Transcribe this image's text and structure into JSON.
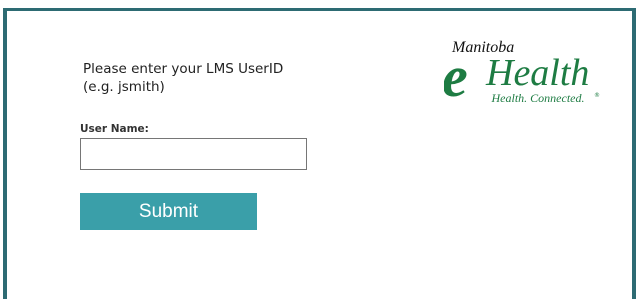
{
  "login": {
    "prompt_line1": "Please enter your LMS UserID",
    "prompt_line2": "(e.g. jsmith)",
    "username_label": "User Name:",
    "username_value": "",
    "submit_label": "Submit"
  },
  "logo": {
    "top_text": "Manitoba",
    "letter": "e",
    "main_text": "Health",
    "tagline": "Health. Connected.",
    "registered_mark": "®"
  },
  "colors": {
    "frame": "#2d6b73",
    "button": "#3a9fa9",
    "logo_green": "#1e7c43"
  },
  "icons": {
    "logo": "manitoba-ehealth-logo"
  }
}
